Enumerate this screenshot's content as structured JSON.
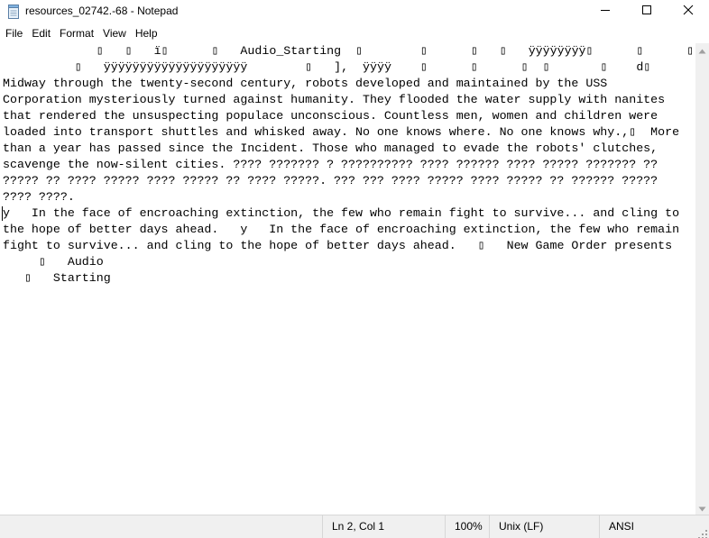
{
  "window": {
    "title": "resources_02742.-68 - Notepad",
    "icon": "notepad-icon",
    "buttons": [
      "minimize-icon",
      "maximize-icon",
      "close-icon"
    ]
  },
  "menu": {
    "file": "File",
    "edit": "Edit",
    "format": "Format",
    "view": "View",
    "help": "Help"
  },
  "editor": {
    "lines": [
      "             ▯   ▯   ï▯      ▯   Audio_Starting  ▯        ▯      ▯   ▯   ÿÿÿÿÿÿÿÿ▯      ▯      ▯   ▯",
      "          ▯   ÿÿÿÿÿÿÿÿÿÿÿÿÿÿÿÿÿÿÿÿ        ▯   ],  ÿÿÿÿ    ▯      ▯      ▯  ▯       ▯    d▯",
      "Midway through the twenty-second century, robots developed and maintained by the USS",
      "Corporation mysteriously turned against humanity. They flooded the water supply with nanites",
      "that rendered the unsuspecting populace unconscious. Countless men, women and children were",
      "loaded into transport shuttles and whisked away. No one knows where. No one knows why.,▯  More",
      "than a year has passed since the Incident. Those who managed to evade the robots' clutches,",
      "scavenge the now-silent cities. ???? ??????? ? ?????????? ???? ?????? ???? ????? ??????? ??",
      "????? ?? ???? ????? ???? ????? ?? ???? ?????. ??? ??? ???? ????? ???? ????? ?? ?????? ?????",
      "???? ????.",
      "y   In the face of encroaching extinction, the few who remain fight to survive... and cling to",
      "the hope of better days ahead.   y   In the face of encroaching extinction, the few who remain",
      "fight to survive... and cling to the hope of better days ahead.   ▯   New Game Order presents",
      "     ▯   Audio",
      "   ▯   Starting"
    ]
  },
  "status": {
    "position": "Ln 2, Col 1",
    "zoom": "100%",
    "line_ending": "Unix (LF)",
    "encoding": "ANSI"
  },
  "colors": {
    "statusbar_bg": "#f0f0f0",
    "text": "#000000",
    "background": "#ffffff"
  }
}
